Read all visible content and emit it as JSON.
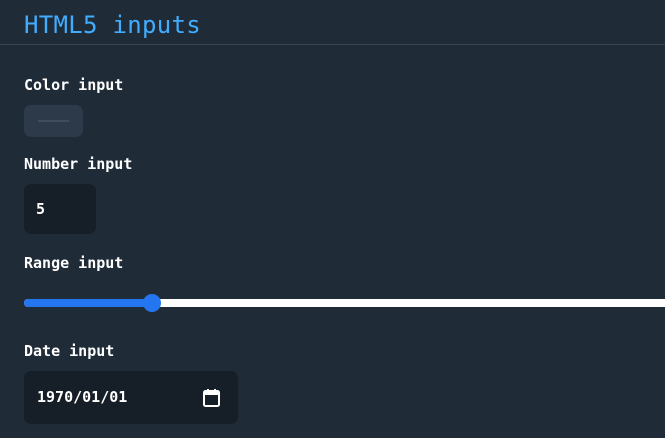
{
  "page": {
    "title": "HTML5 inputs"
  },
  "color_input": {
    "label": "Color input",
    "value": "#1e2733"
  },
  "number_input": {
    "label": "Number input",
    "value": "5"
  },
  "range_input": {
    "label": "Range input",
    "value_fraction": 0.2
  },
  "date_input": {
    "label": "Date input",
    "value": "1970/01/01",
    "icon": "calendar-icon"
  },
  "colors": {
    "background": "#202b38",
    "title": "#41adff",
    "field_background": "#161f27",
    "range_accent": "#2375f0",
    "range_track": "#ffffff"
  }
}
